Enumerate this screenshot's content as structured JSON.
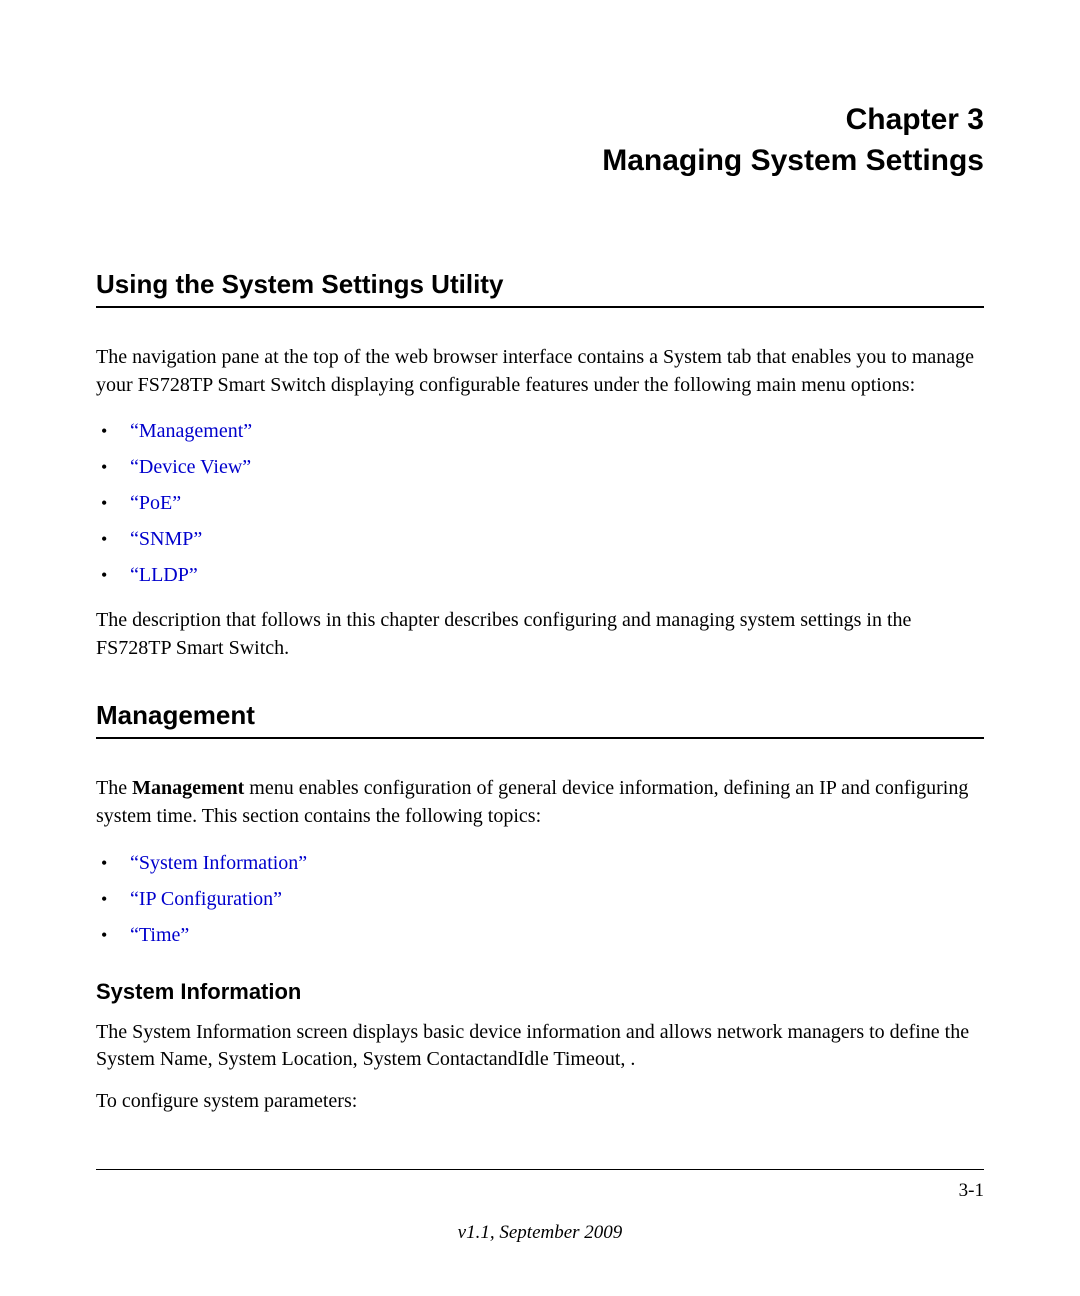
{
  "chapter": {
    "label": "Chapter 3",
    "title": "Managing System Settings"
  },
  "sections": {
    "using_utility": {
      "heading": "Using the System Settings Utility",
      "para1": "The navigation pane at the top of the web browser interface contains a System tab that enables you to manage your FS728TP Smart Switch displaying configurable features under the following main menu options:",
      "links": [
        "“Management”",
        "“Device View”",
        "“PoE”",
        "“SNMP”",
        "“LLDP”"
      ],
      "para2": "The description that follows in this chapter describes configuring and managing system settings in the FS728TP Smart Switch."
    },
    "management": {
      "heading": "Management",
      "intro_pre": "The ",
      "intro_bold": "Management",
      "intro_post": " menu enables configuration of general device information, defining an IP and configuring system time. This section contains the following topics:",
      "links": [
        "“System Information”",
        "“IP Configuration”",
        "“Time”"
      ]
    },
    "system_info": {
      "heading": "System Information",
      "para1": "The System Information screen displays basic device information and allows network managers to define the System Name, System Location, System ContactandIdle Timeout, .",
      "para2": "To configure system parameters:"
    }
  },
  "footer": {
    "page": "3-1",
    "version": "v1.1, September 2009"
  }
}
